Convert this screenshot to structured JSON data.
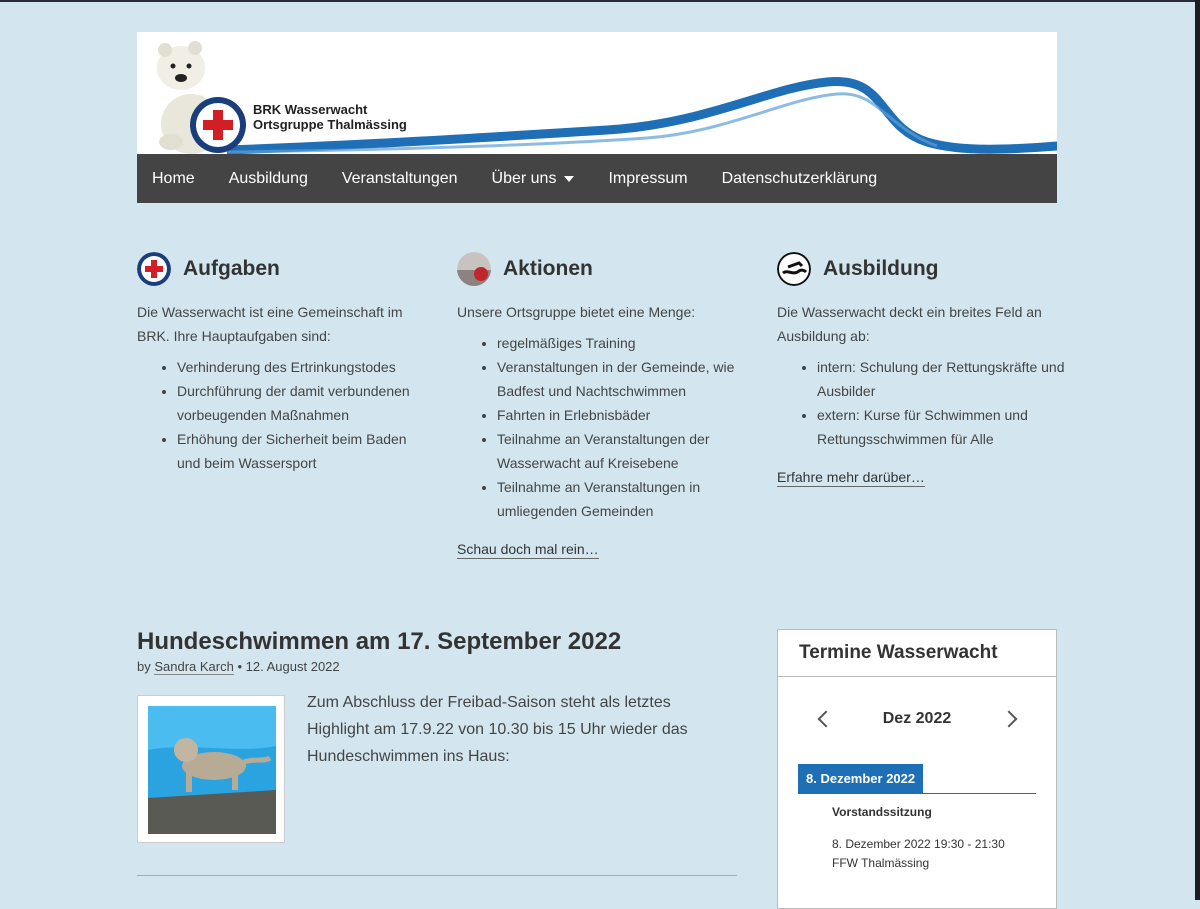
{
  "header": {
    "title_line1": "BRK Wasserwacht",
    "title_line2": "Ortsgruppe Thalmässing"
  },
  "nav": {
    "items": [
      {
        "label": "Home"
      },
      {
        "label": "Ausbildung"
      },
      {
        "label": "Veranstaltungen"
      },
      {
        "label": "Über uns",
        "has_dropdown": true
      },
      {
        "label": "Impressum"
      },
      {
        "label": "Datenschutzerklärung"
      }
    ]
  },
  "columns": [
    {
      "title": "Aufgaben",
      "intro": "Die Wasserwacht ist eine Gemeinschaft im BRK. Ihre Hauptaufgaben sind:",
      "items": [
        "Verhinderung des Ertrinkungstodes",
        "Durchführung der damit verbundenen vorbeugenden Maßnahmen",
        "Erhöhung der Sicherheit beim Baden und beim Wassersport"
      ],
      "link": ""
    },
    {
      "title": "Aktionen",
      "intro": "Unsere Ortsgruppe bietet eine Menge:",
      "items": [
        "regelmäßiges Training",
        "Veranstaltungen in der Gemeinde, wie Badfest und Nachtschwimmen",
        "Fahrten in Erlebnisbäder",
        "Teilnahme an Veranstaltungen der Wasserwacht auf Kreisebene",
        "Teilnahme an Veranstaltungen in umliegenden Gemeinden"
      ],
      "link": "Schau doch mal rein…"
    },
    {
      "title": "Ausbildung",
      "intro": "Die Wasserwacht deckt ein breites Feld an Ausbildung ab:",
      "items": [
        "intern: Schulung der Rettungskräfte und Ausbilder",
        "extern: Kurse für Schwimmen und Rettungsschwimmen für Alle"
      ],
      "link": "Erfahre mehr darüber…"
    }
  ],
  "post": {
    "title": "Hundeschwimmen am 17. September 2022",
    "by": "by",
    "author": "Sandra Karch",
    "separator": "•",
    "date": "12. August 2022",
    "excerpt": "Zum Abschluss der Freibad-Saison steht als letztes Highlight am 17.9.22 von 10.30 bis 15 Uhr wieder das Hundeschwimmen ins Haus:"
  },
  "widget": {
    "title": "Termine Wasserwacht",
    "month": "Dez 2022",
    "day_label": "8. Dezember 2022",
    "event_title": "Vorstandssitzung",
    "event_time": "8. Dezember 2022  19:30 - 21:30",
    "event_place": "FFW Thalmässing"
  },
  "colors": {
    "background": "#d3e6ef",
    "nav": "#444444",
    "accent": "#1f6fb7"
  }
}
